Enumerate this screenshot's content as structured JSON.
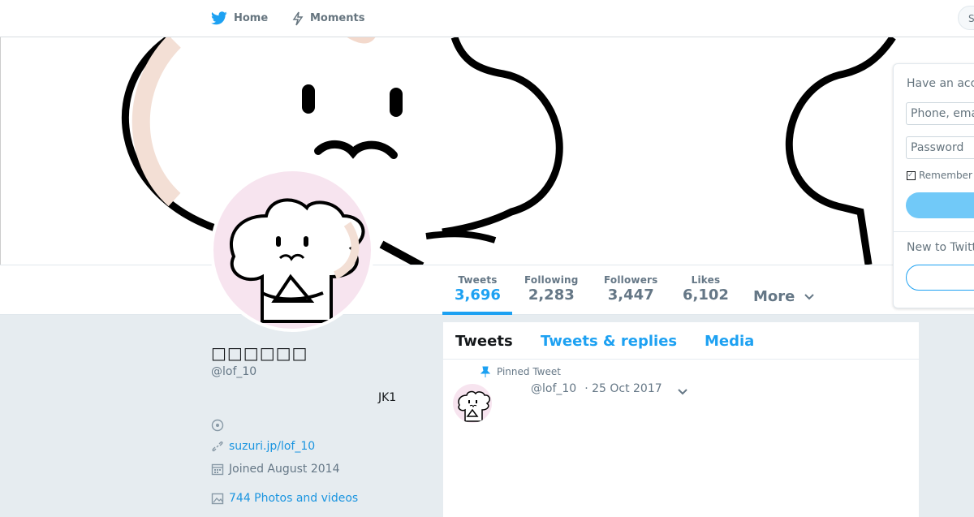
{
  "nav": {
    "home_label": "Home",
    "moments_label": "Moments",
    "search_stub": "S"
  },
  "stats": [
    {
      "label": "Tweets",
      "value": "3,696"
    },
    {
      "label": "Following",
      "value": "2,283"
    },
    {
      "label": "Followers",
      "value": "3,447"
    },
    {
      "label": "Likes",
      "value": "6,102"
    }
  ],
  "more_label": "More",
  "profile": {
    "name": "□□□□□□",
    "handle": "@lof_10",
    "bio": "JK1",
    "website": "suzuri.jp/lof_10",
    "joined": "Joined August 2014",
    "media": "744 Photos and videos"
  },
  "tabs": [
    "Tweets",
    "Tweets & replies",
    "Media"
  ],
  "tweet": {
    "pinned_label": "Pinned Tweet",
    "handle": "@lof_10",
    "date": "· 25 Oct 2017"
  },
  "login": {
    "title": "Have an account?",
    "phone_placeholder": "Phone, email or username",
    "password_placeholder": "Password",
    "remember": "Remember me",
    "new_label": "New to Twitter?"
  },
  "colors": {
    "accent": "#1da1f2",
    "link": "#1b95e0",
    "avatar_bg": "#f7e4ef"
  },
  "icons": [
    "twitter-bird-icon",
    "lightning-icon",
    "location-icon",
    "link-icon",
    "calendar-icon",
    "photo-icon",
    "pin-icon",
    "chevron-down-icon"
  ]
}
